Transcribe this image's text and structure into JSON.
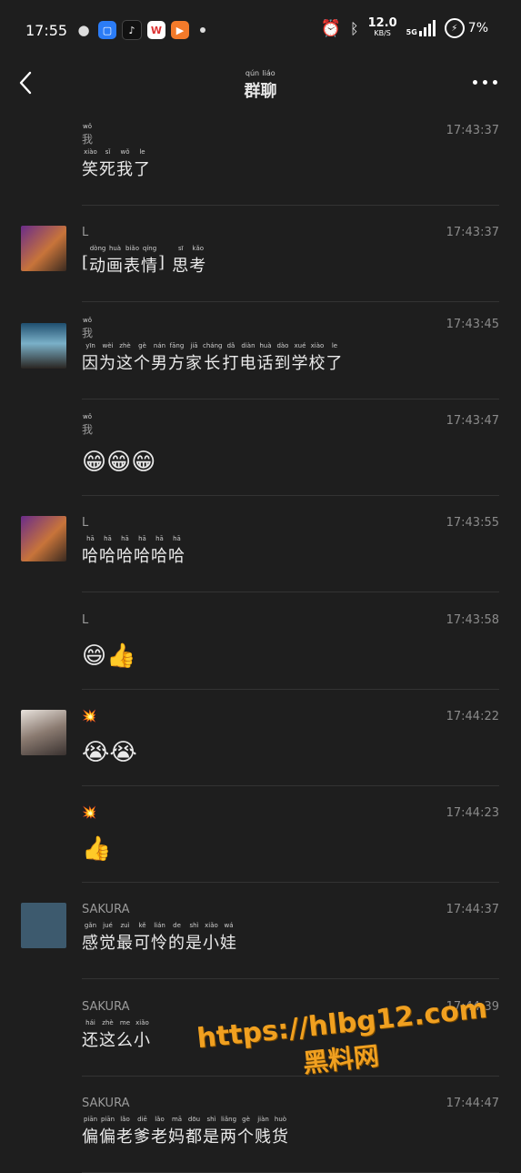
{
  "status": {
    "time": "17:55",
    "speed_value": "12.0",
    "speed_unit": "KB/S",
    "network": "5G",
    "battery": "7%"
  },
  "nav": {
    "title_hz": [
      "群",
      "聊"
    ],
    "title_py": [
      "qún",
      "liáo"
    ]
  },
  "messages": [
    {
      "name": "我",
      "name_py": "wǒ",
      "time": "17:43:37",
      "avatar": "none",
      "hz": [
        "笑",
        "死",
        "我",
        "了"
      ],
      "py": [
        "xiào",
        "sǐ",
        "wǒ",
        "le"
      ]
    },
    {
      "name": "L",
      "time": "17:43:37",
      "avatar": "purple",
      "hz": [
        "[",
        "动",
        "画",
        "表",
        "情",
        "]",
        " ",
        "思",
        "考"
      ],
      "py": [
        "",
        "dòng",
        "huà",
        "biǎo",
        "qíng",
        "",
        "",
        "sī",
        "kǎo"
      ]
    },
    {
      "name": "我",
      "name_py": "wǒ",
      "time": "17:43:45",
      "avatar": "teal",
      "hz": [
        "因",
        "为",
        "这",
        "个",
        "男",
        "方",
        "家",
        "长",
        "打",
        "电",
        "话",
        "到",
        "学",
        "校",
        "了"
      ],
      "py": [
        "yīn",
        "wèi",
        "zhè",
        "gè",
        "nán",
        "fāng",
        "jiā",
        "cháng",
        "dǎ",
        "diàn",
        "huà",
        "dào",
        "xué",
        "xiào",
        "le"
      ]
    },
    {
      "name": "我",
      "name_py": "wǒ",
      "time": "17:43:47",
      "avatar": "none",
      "emoji": "😁😁😁"
    },
    {
      "name": "L",
      "time": "17:43:55",
      "avatar": "purple",
      "hz": [
        "哈",
        "哈",
        "哈",
        "哈",
        "哈",
        "哈"
      ],
      "py": [
        "hā",
        "hā",
        "hā",
        "hā",
        "hā",
        "hā"
      ]
    },
    {
      "name": "L",
      "time": "17:43:58",
      "avatar": "none",
      "emoji": "😄👍"
    },
    {
      "name": "💥",
      "time": "17:44:22",
      "avatar": "photo",
      "emoji": "😭😭"
    },
    {
      "name": "💥",
      "time": "17:44:23",
      "avatar": "none",
      "emoji": "👍"
    },
    {
      "name": "SAKURA",
      "time": "17:44:37",
      "avatar": "slate",
      "hz": [
        "感",
        "觉",
        "最",
        "可",
        "怜",
        "的",
        "是",
        "小",
        "娃"
      ],
      "py": [
        "gǎn",
        "jué",
        "zuì",
        "kě",
        "lián",
        "de",
        "shì",
        "xiǎo",
        "wá"
      ]
    },
    {
      "name": "SAKURA",
      "time": "17:44:39",
      "avatar": "none",
      "hz": [
        "还",
        "这",
        "么",
        "小"
      ],
      "py": [
        "hái",
        "zhè",
        "me",
        "xiǎo"
      ]
    },
    {
      "name": "SAKURA",
      "time": "17:44:47",
      "avatar": "none",
      "hz": [
        "偏",
        "偏",
        "老",
        "爹",
        "老",
        "妈",
        "都",
        "是",
        "两",
        "个",
        "贱",
        "货"
      ],
      "py": [
        "piān",
        "piān",
        "lǎo",
        "diē",
        "lǎo",
        "mā",
        "dōu",
        "shì",
        "liǎng",
        "gè",
        "jiàn",
        "huò"
      ]
    }
  ],
  "watermark": {
    "url": "https://hlbg12.com",
    "text": "黑料网"
  },
  "colors": {
    "bg": "#1e1e1e",
    "text": "#e6e6e6",
    "muted": "#8a8a8a",
    "watermark": "#f0a020"
  }
}
